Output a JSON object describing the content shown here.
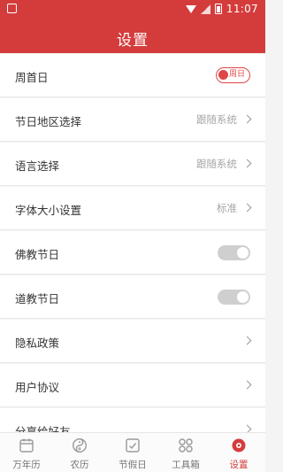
{
  "status_bar": {
    "time": "11:07"
  },
  "header": {
    "title": "设置"
  },
  "settings": [
    {
      "label": "周首日",
      "control": "toggle-on",
      "toggle_text": "周日"
    },
    {
      "label": "节日地区选择",
      "value": "跟随系统"
    },
    {
      "label": "语言选择",
      "value": "跟随系统"
    },
    {
      "label": "字体大小设置",
      "value": "标准"
    },
    {
      "label": "佛教节日",
      "control": "toggle-off"
    },
    {
      "label": "道教节日",
      "control": "toggle-off"
    },
    {
      "label": "隐私政策"
    },
    {
      "label": "用户协议"
    },
    {
      "label": "分享给好友"
    }
  ],
  "tabbar": {
    "items": [
      {
        "label": "万年历",
        "icon": "calendar-icon"
      },
      {
        "label": "农历",
        "icon": "yin-yang-icon"
      },
      {
        "label": "节假日",
        "icon": "holiday-calendar-icon"
      },
      {
        "label": "工具箱",
        "icon": "toolbox-grid-icon"
      },
      {
        "label": "设置",
        "icon": "settings-gear-icon",
        "active": true
      }
    ]
  },
  "colors": {
    "accent": "#d43c3c",
    "toggle_on": "#e04646",
    "toggle_off": "#cfcfcf"
  }
}
